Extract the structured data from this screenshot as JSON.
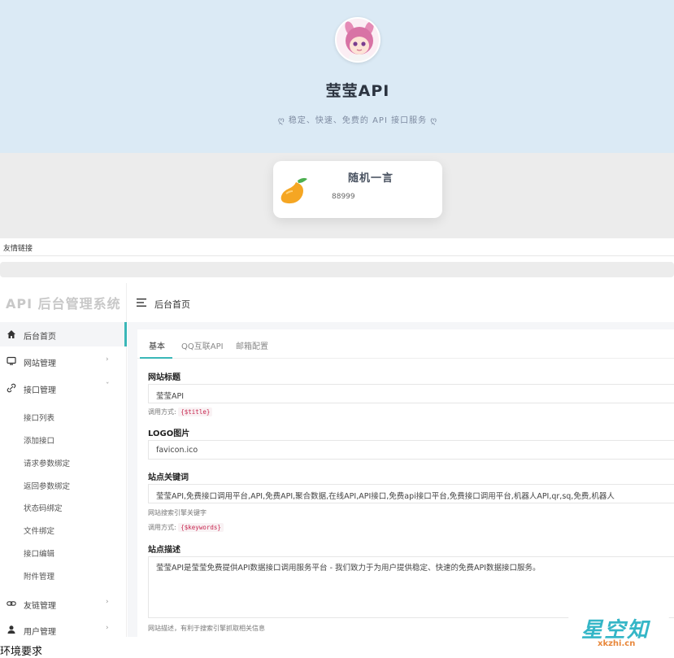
{
  "public_page": {
    "site_name": "莹莹API",
    "tagline": "稳定、快速、免费的 API 接口服务",
    "quote_card": {
      "title": "随机一言",
      "text": "88999"
    },
    "friends_label": "友情链接"
  },
  "admin": {
    "brand": "API 后台管理系统",
    "breadcrumb": "后台首页",
    "menu": [
      {
        "label": "后台首页",
        "icon": "home-icon",
        "active": true
      },
      {
        "label": "网站管理",
        "icon": "monitor-icon",
        "chevron": "›"
      },
      {
        "label": "接口管理",
        "icon": "link-icon",
        "chevron": "ˇ"
      },
      {
        "label": "友链管理",
        "icon": "chain-icon",
        "chevron": "›"
      },
      {
        "label": "用户管理",
        "icon": "user-icon",
        "chevron": "›"
      }
    ],
    "submenu": [
      "接口列表",
      "添加接口",
      "请求参数绑定",
      "返回参数绑定",
      "状态码绑定",
      "文件绑定",
      "接口编辑",
      "附件管理"
    ],
    "tabs": [
      "基本",
      "QQ互联API",
      "邮箱配置"
    ],
    "form": {
      "site_title": {
        "label": "网站标题",
        "value": "莹莹API",
        "help_prefix": "调用方式:",
        "help_code": "{$title}"
      },
      "logo": {
        "label": "LOGO图片",
        "value": "favicon.ico"
      },
      "keywords": {
        "label": "站点关键词",
        "value": "莹莹API,免费接口调用平台,API,免费API,聚合数据,在线API,API接口,免费api接口平台,免费接口调用平台,机器人API,qr,sq,免费,机器人",
        "help1": "网站搜索引擎关键字",
        "help_prefix": "调用方式:",
        "help_code": "{$keywords}"
      },
      "description": {
        "label": "站点描述",
        "value": "莹莹API是莹莹免费提供API数据接口调用服务平台 - 我们致力于为用户提供稳定、快速的免费API数据接口服务。",
        "help": "网站描述，有利于搜索引擎抓取相关信息"
      }
    }
  },
  "watermark": {
    "big": "星空知",
    "small": "xkzhi.cn"
  },
  "footer_text": "环境要求",
  "colors": {
    "accent": "#3ab7b8",
    "hero_bg": "#dbeaf5"
  }
}
